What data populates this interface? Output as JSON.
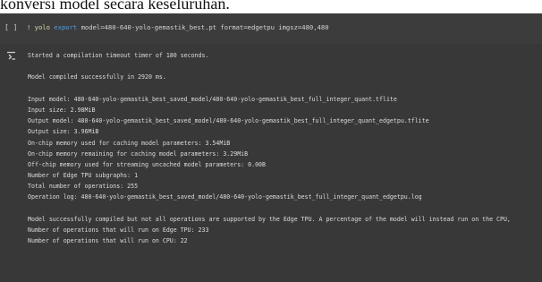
{
  "document": {
    "caption_fragment": "konversi model secara keseluruhan."
  },
  "cell": {
    "run_indicator": "[ ]",
    "prefix": "!",
    "command": "yolo",
    "subcommand": "export",
    "args": " model=480-640-yolo-gemastik_best.pt format=edgetpu imgsz=480,480"
  },
  "output": {
    "lines": [
      "Started a compilation timeout timer of 180 seconds.",
      "",
      "Model compiled successfully in 2920 ms.",
      "",
      "Input model: 480-640-yolo-gemastik_best_saved_model/480-640-yolo-gemastik_best_full_integer_quant.tflite",
      "Input size: 2.98MiB",
      "Output model: 480-640-yolo-gemastik_best_saved_model/480-640-yolo-gemastik_best_full_integer_quant_edgetpu.tflite",
      "Output size: 3.96MiB",
      "On-chip memory used for caching model parameters: 3.54MiB",
      "On-chip memory remaining for caching model parameters: 3.29MiB",
      "Off-chip memory used for streaming uncached model parameters: 0.00B",
      "Number of Edge TPU subgraphs: 1",
      "Total number of operations: 255",
      "Operation log: 480-640-yolo-gemastik_best_saved_model/480-640-yolo-gemastik_best_full_integer_quant_edgetpu.log",
      "",
      "Model successfully compiled but not all operations are supported by the Edge TPU. A percentage of the model will instead run on the CPU,",
      "Number of operations that will run on Edge TPU: 233",
      "Number of operations that will run on CPU: 22"
    ]
  }
}
